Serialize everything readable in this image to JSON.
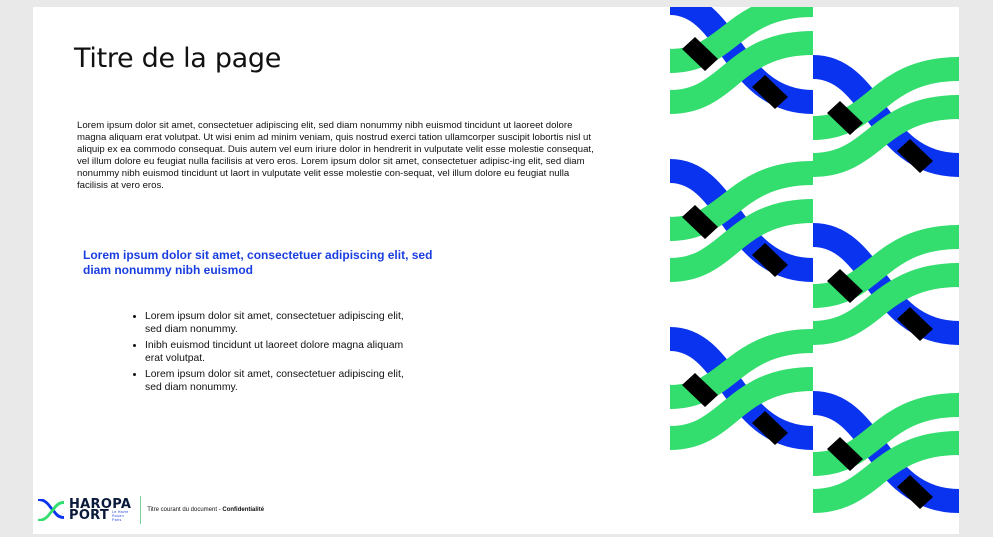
{
  "page": {
    "title": "Titre de la page",
    "body_text": "Lorem ipsum dolor sit amet, consectetuer adipiscing elit, sed diam nonummy nibh euismod tincidunt ut laoreet dolore magna aliquam erat volutpat. Ut wisi enim ad minim veniam, quis nostrud exerci tation ullamcorper suscipit lobortis nisl ut aliquip ex ea commodo consequat. Duis autem vel eum iriure dolor in hendrerit in vulputate velit esse molestie consequat, vel illum dolore eu feugiat nulla facilisis at vero eros. Lorem ipsum dolor sit amet, consectetuer adipisc-ing elit, sed diam nonummy nibh euismod tincidunt ut laort in vulputate velit esse molestie con-sequat, vel illum dolore eu feugiat nulla facilisis at vero eros.",
    "highlight": "Lorem ipsum dolor sit amet, consectetuer adipiscing elit, sed diam nonummy nibh euismod",
    "bullets": [
      "Lorem ipsum dolor sit amet, consectetuer adipiscing elit, sed diam nonummy.",
      "Inibh euismod tincidunt ut laoreet dolore magna aliquam erat volutpat.",
      "Lorem ipsum dolor sit amet, consectetuer adipiscing elit, sed diam nonummy."
    ]
  },
  "footer": {
    "logo_line1": "HAROPA",
    "logo_line2": "PORT",
    "logo_sub1": "Le Havre",
    "logo_sub2": "Rouen",
    "logo_sub3": "Paris",
    "caption": "Titre courant du document - ",
    "caption_bold": "Confidentialité"
  },
  "colors": {
    "green": "#33dd6e",
    "blue": "#0a33f0",
    "black": "#000000",
    "accent_text": "#1a3ee0"
  }
}
